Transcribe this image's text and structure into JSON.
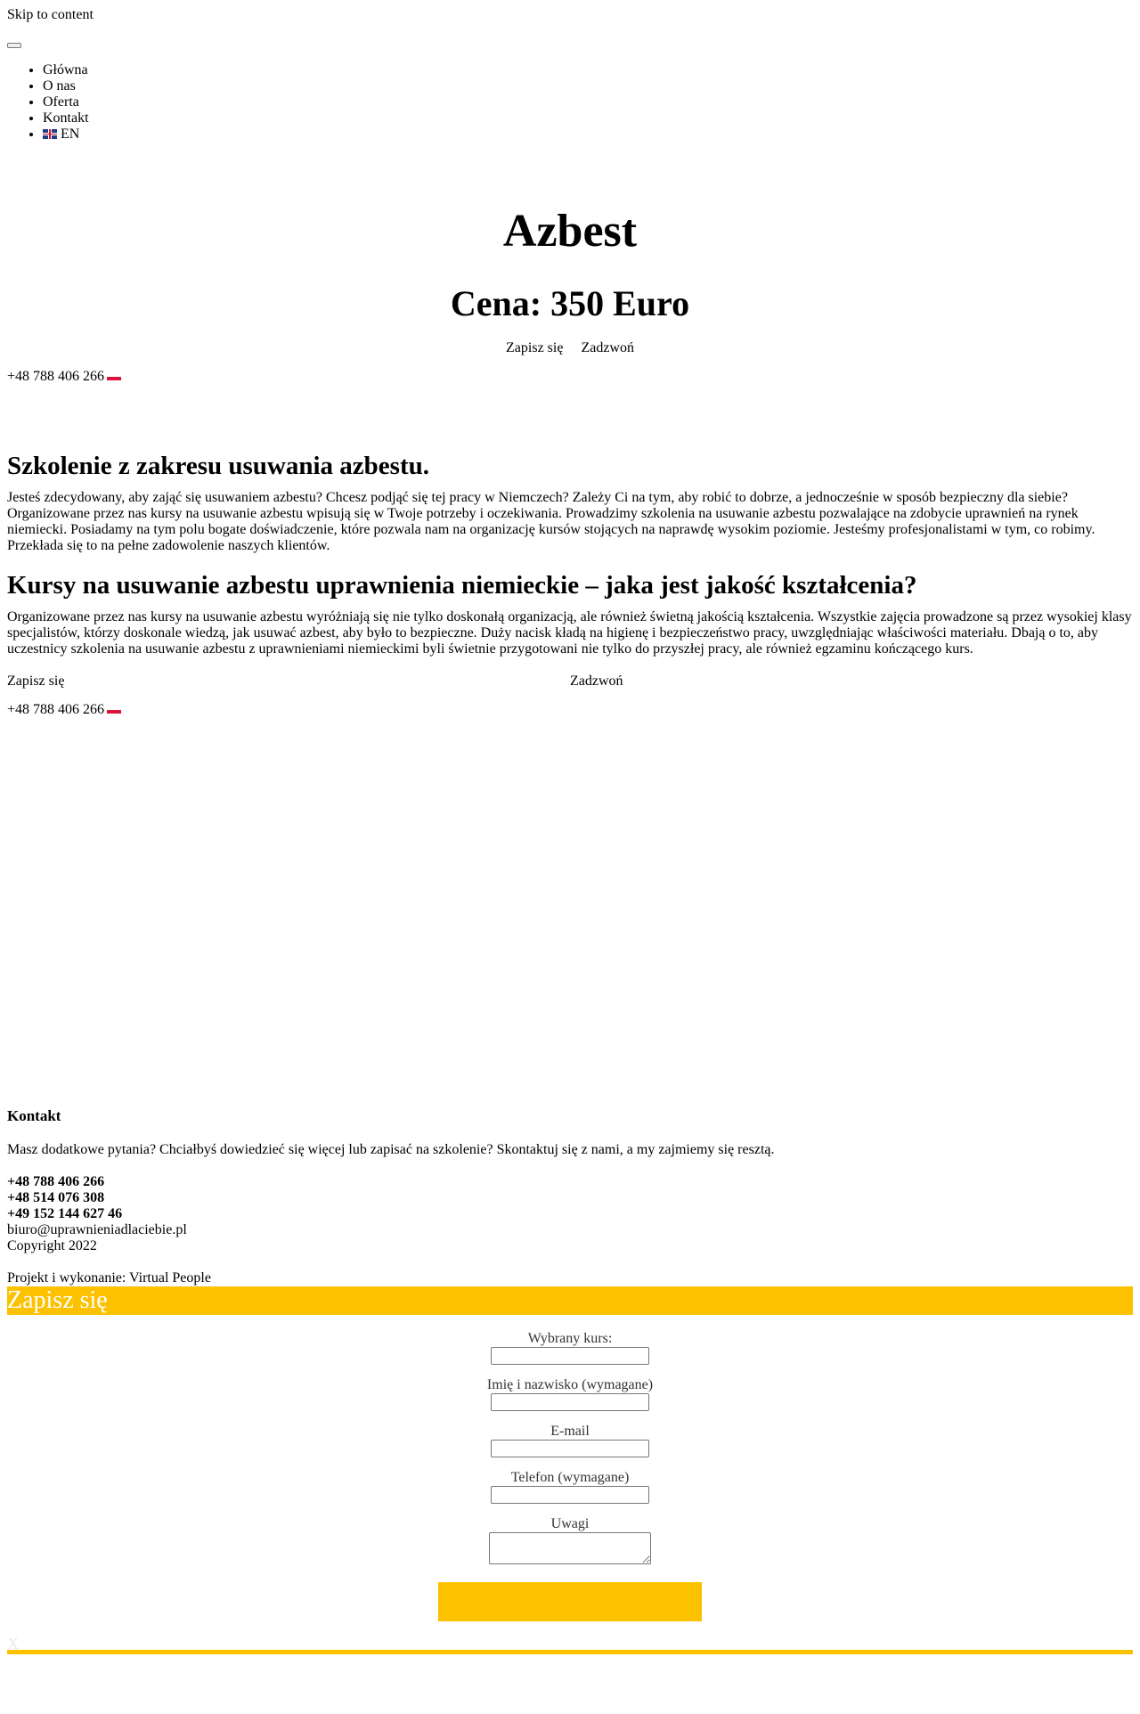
{
  "skip_link": "Skip to content",
  "nav": {
    "items": [
      {
        "label": "Główna"
      },
      {
        "label": "O nas"
      },
      {
        "label": "Oferta"
      },
      {
        "label": "Kontakt"
      }
    ],
    "language": "EN"
  },
  "hero": {
    "title": "Azbest",
    "price": "Cena: 350 Euro",
    "signup_label": "Zapisz się",
    "call_label": "Zadzwoń",
    "phone": "+48 788 406 266"
  },
  "section1": {
    "heading": "Szkolenie z zakresu usuwania azbestu.",
    "body": "Jesteś zdecydowany, aby zająć się usuwaniem azbestu? Chcesz podjąć się tej pracy w Niemczech? Zależy Ci na tym, aby robić to dobrze, a jednocześnie w sposób bezpieczny dla siebie? Organizowane przez nas kursy na usuwanie azbestu wpisują się w Twoje potrzeby i oczekiwania. Prowadzimy szkolenia na usuwanie azbestu pozwalające na zdobycie uprawnień na rynek niemiecki. Posiadamy na tym polu bogate doświadczenie, które pozwala nam na organizację kursów stojących na naprawdę wysokim poziomie. Jesteśmy profesjonalistami w tym, co robimy. Przekłada się to na pełne zadowolenie naszych klientów."
  },
  "section2": {
    "heading": "Kursy na usuwanie azbestu uprawnienia niemieckie – jaka jest jakość kształcenia?",
    "body": "Organizowane przez nas kursy na usuwanie azbestu wyróżniają się nie tylko doskonałą organizacją, ale również świetną jakością kształcenia. Wszystkie zajęcia prowadzone są przez wysokiej klasy specjalistów, którzy doskonale wiedzą, jak usuwać azbest, aby było to bezpieczne. Duży nacisk kładą na higienę i bezpieczeństwo pracy, uwzględniając właściwości materiału. Dbają o to, aby uczestnicy szkolenia na usuwanie azbestu z uprawnieniami niemieckimi byli świetnie przygotowani nie tylko do przyszłej pracy, ale również egzaminu kończącego kurs.",
    "signup_label": "Zapisz się",
    "call_label": "Zadzwoń",
    "phone": "+48 788 406 266"
  },
  "footer": {
    "heading": "Kontakt",
    "text": "Masz dodatkowe pytania? Chciałbyś dowiedzieć się więcej lub zapisać na szkolenie? Skontaktuj się z nami, a my zajmiemy się resztą.",
    "phones": [
      "+48 788 406 266",
      "+48 514 076 308",
      "+49 152 144 627 46"
    ],
    "email": "biuro@uprawnieniadlaciebie.pl",
    "copyright": "Copyright 2022",
    "credits": "Projekt i wykonanie: Virtual People"
  },
  "modal": {
    "title": "Zapisz się",
    "fields": [
      {
        "label": "Wybrany kurs:",
        "value": ""
      },
      {
        "label": "Imię i nazwisko (wymagane)",
        "value": ""
      },
      {
        "label": "E-mail",
        "value": ""
      },
      {
        "label": "Telefon (wymagane)",
        "value": ""
      }
    ],
    "notes_label": "Uwagi",
    "close": "X"
  },
  "colors": {
    "accent": "#fcc200",
    "flag_pl_white": "#ffffff",
    "flag_pl_red": "#dc143c"
  }
}
